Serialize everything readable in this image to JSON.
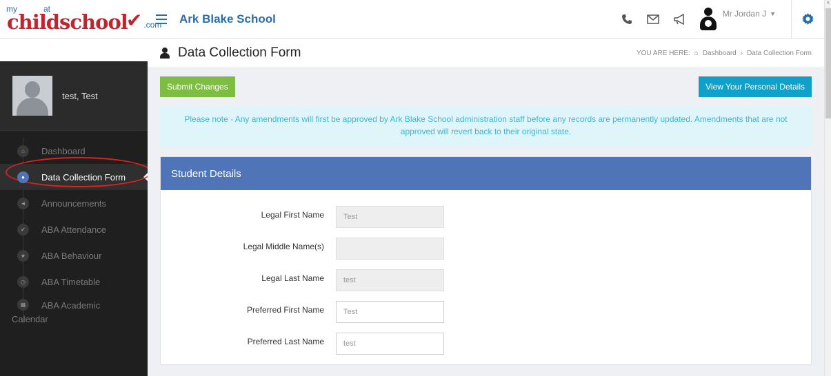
{
  "topbar": {
    "logo": {
      "my": "my",
      "main": "childschool",
      "at": "at",
      "dotcom": ".com"
    },
    "school_name": "Ark Blake School",
    "icons": [
      "phone-icon",
      "envelope-icon",
      "megaphone-icon"
    ],
    "user_name": "Mr Jordan J",
    "accent_color": "#2a6ea8"
  },
  "titlebar": {
    "title": "Data Collection Form",
    "breadcrumb": {
      "prefix": "YOU ARE HERE:",
      "home": "Dashboard",
      "separator": "›",
      "current": "Data Collection Form"
    }
  },
  "sidebar": {
    "profile_name": "test, Test",
    "items": [
      {
        "label": "Dashboard",
        "icon": "home-icon",
        "active": false
      },
      {
        "label": "Data Collection Form",
        "icon": "user-icon",
        "active": true
      },
      {
        "label": "Announcements",
        "icon": "megaphone-icon",
        "active": false
      },
      {
        "label": "ABA Attendance",
        "icon": "check-icon",
        "active": false
      },
      {
        "label": "ABA Behaviour",
        "icon": "star-icon",
        "active": false
      },
      {
        "label": "ABA Timetable",
        "icon": "clock-icon",
        "active": false
      },
      {
        "label": "ABA Academic",
        "label_line2": "Calendar",
        "icon": "calendar-icon",
        "active": false
      }
    ]
  },
  "actions": {
    "submit_label": "Submit Changes",
    "view_details_label": "View Your Personal Details"
  },
  "notice": "Please note - Any amendments will first be approved by Ark Blake School administration staff before any records are permanently updated. Amendments that are not approved will revert back to their original state.",
  "panel": {
    "title": "Student Details",
    "fields": [
      {
        "label": "Legal First Name",
        "value": "Test",
        "readonly": true
      },
      {
        "label": "Legal Middle Name(s)",
        "value": "",
        "readonly": true
      },
      {
        "label": "Legal Last Name",
        "value": "test",
        "readonly": true
      },
      {
        "label": "Preferred First Name",
        "value": "Test",
        "readonly": false
      },
      {
        "label": "Preferred Last Name",
        "value": "test",
        "readonly": false
      }
    ]
  },
  "colors": {
    "header_blue": "#4f74b8",
    "submit_green": "#7cbd42",
    "details_teal": "#0fa1c9",
    "notice_bg": "#dff5fa",
    "sidebar_bg": "#1f1f1f"
  }
}
